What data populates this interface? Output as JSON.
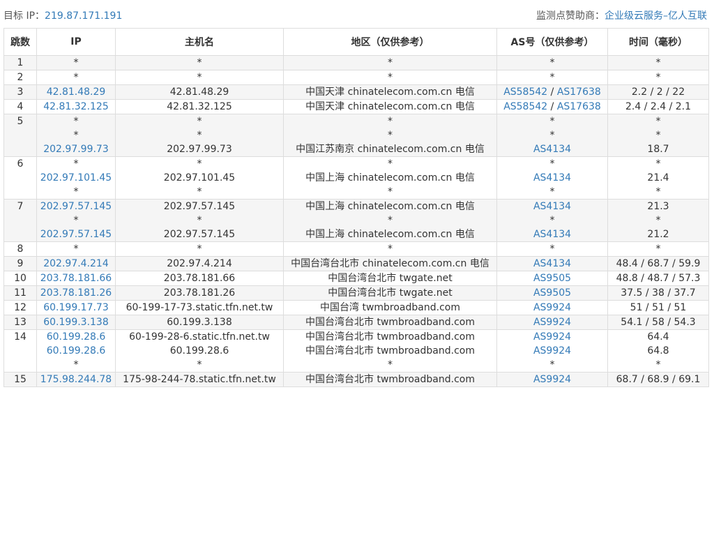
{
  "header": {
    "target_label": "目标 IP：",
    "target_ip": "219.87.171.191",
    "sponsor_label": "监测点赞助商：",
    "sponsor_name": "企业级云服务–亿人互联"
  },
  "columns": [
    "跳数",
    "IP",
    "主机名",
    "地区（仅供参考）",
    "AS号（仅供参考）",
    "时间（毫秒）"
  ],
  "hops": [
    {
      "hop": "1",
      "lines": [
        {
          "ip": "*",
          "host": "*",
          "region": "*",
          "as": [
            "*"
          ],
          "time": "*"
        }
      ]
    },
    {
      "hop": "2",
      "lines": [
        {
          "ip": "*",
          "host": "*",
          "region": "*",
          "as": [
            "*"
          ],
          "time": "*"
        }
      ]
    },
    {
      "hop": "3",
      "lines": [
        {
          "ip": "42.81.48.29",
          "host": "42.81.48.29",
          "region": "中国天津 chinatelecom.com.cn 电信",
          "as": [
            "AS58542",
            "AS17638"
          ],
          "time": "2.2 / 2 / 22"
        }
      ]
    },
    {
      "hop": "4",
      "lines": [
        {
          "ip": "42.81.32.125",
          "host": "42.81.32.125",
          "region": "中国天津 chinatelecom.com.cn 电信",
          "as": [
            "AS58542",
            "AS17638"
          ],
          "time": "2.4 / 2.4 / 2.1"
        }
      ]
    },
    {
      "hop": "5",
      "lines": [
        {
          "ip": "*",
          "host": "*",
          "region": "*",
          "as": [
            "*"
          ],
          "time": "*"
        },
        {
          "ip": "*",
          "host": "*",
          "region": "*",
          "as": [
            "*"
          ],
          "time": "*"
        },
        {
          "ip": "202.97.99.73",
          "host": "202.97.99.73",
          "region": "中国江苏南京 chinatelecom.com.cn 电信",
          "as": [
            "AS4134"
          ],
          "time": "18.7"
        }
      ]
    },
    {
      "hop": "6",
      "lines": [
        {
          "ip": "*",
          "host": "*",
          "region": "*",
          "as": [
            "*"
          ],
          "time": "*"
        },
        {
          "ip": "202.97.101.45",
          "host": "202.97.101.45",
          "region": "中国上海 chinatelecom.com.cn 电信",
          "as": [
            "AS4134"
          ],
          "time": "21.4"
        },
        {
          "ip": "*",
          "host": "*",
          "region": "*",
          "as": [
            "*"
          ],
          "time": "*"
        }
      ]
    },
    {
      "hop": "7",
      "lines": [
        {
          "ip": "202.97.57.145",
          "host": "202.97.57.145",
          "region": "中国上海 chinatelecom.com.cn 电信",
          "as": [
            "AS4134"
          ],
          "time": "21.3"
        },
        {
          "ip": "*",
          "host": "*",
          "region": "*",
          "as": [
            "*"
          ],
          "time": "*"
        },
        {
          "ip": "202.97.57.145",
          "host": "202.97.57.145",
          "region": "中国上海 chinatelecom.com.cn 电信",
          "as": [
            "AS4134"
          ],
          "time": "21.2"
        }
      ]
    },
    {
      "hop": "8",
      "lines": [
        {
          "ip": "*",
          "host": "*",
          "region": "*",
          "as": [
            "*"
          ],
          "time": "*"
        }
      ]
    },
    {
      "hop": "9",
      "lines": [
        {
          "ip": "202.97.4.214",
          "host": "202.97.4.214",
          "region": "中国台湾台北市 chinatelecom.com.cn 电信",
          "as": [
            "AS4134"
          ],
          "time": "48.4 / 68.7 / 59.9"
        }
      ]
    },
    {
      "hop": "10",
      "lines": [
        {
          "ip": "203.78.181.66",
          "host": "203.78.181.66",
          "region": "中国台湾台北市 twgate.net",
          "as": [
            "AS9505"
          ],
          "time": "48.8 / 48.7 / 57.3"
        }
      ]
    },
    {
      "hop": "11",
      "lines": [
        {
          "ip": "203.78.181.26",
          "host": "203.78.181.26",
          "region": "中国台湾台北市 twgate.net",
          "as": [
            "AS9505"
          ],
          "time": "37.5 / 38 / 37.7"
        }
      ]
    },
    {
      "hop": "12",
      "lines": [
        {
          "ip": "60.199.17.73",
          "host": "60-199-17-73.static.tfn.net.tw",
          "region": "中国台湾 twmbroadband.com",
          "as": [
            "AS9924"
          ],
          "time": "51 / 51 / 51"
        }
      ]
    },
    {
      "hop": "13",
      "lines": [
        {
          "ip": "60.199.3.138",
          "host": "60.199.3.138",
          "region": "中国台湾台北市 twmbroadband.com",
          "as": [
            "AS9924"
          ],
          "time": "54.1 / 58 / 54.3"
        }
      ]
    },
    {
      "hop": "14",
      "lines": [
        {
          "ip": "60.199.28.6",
          "host": "60-199-28-6.static.tfn.net.tw",
          "region": "中国台湾台北市 twmbroadband.com",
          "as": [
            "AS9924"
          ],
          "time": "64.4"
        },
        {
          "ip": "60.199.28.6",
          "host": "60.199.28.6",
          "region": "中国台湾台北市 twmbroadband.com",
          "as": [
            "AS9924"
          ],
          "time": "64.8"
        },
        {
          "ip": "*",
          "host": "*",
          "region": "*",
          "as": [
            "*"
          ],
          "time": "*"
        }
      ]
    },
    {
      "hop": "15",
      "lines": [
        {
          "ip": "175.98.244.78",
          "host": "175-98-244-78.static.tfn.net.tw",
          "region": "中国台湾台北市 twmbroadband.com",
          "as": [
            "AS9924"
          ],
          "time": "68.7 / 68.9 / 69.1"
        }
      ]
    }
  ]
}
